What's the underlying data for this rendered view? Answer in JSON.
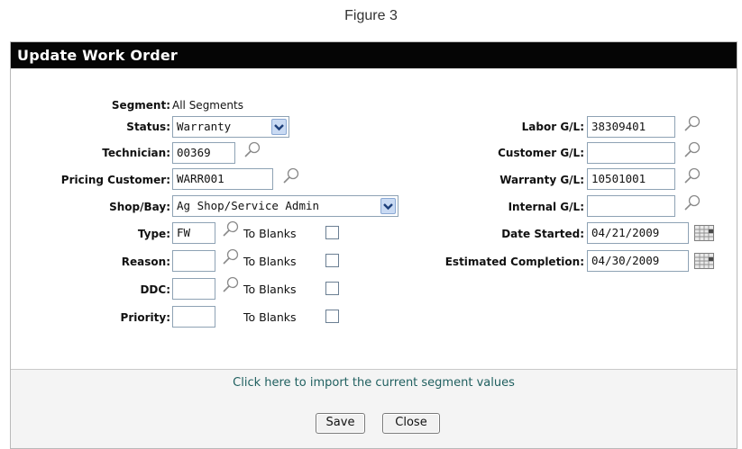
{
  "caption": "Figure 3",
  "dialog": {
    "title": "Update Work Order",
    "segment": {
      "label": "Segment:",
      "value": "All Segments"
    },
    "status": {
      "label": "Status:",
      "value": "Warranty"
    },
    "technician": {
      "label": "Technician:",
      "value": "00369"
    },
    "pricing_customer": {
      "label": "Pricing Customer:",
      "value": "WARR001"
    },
    "shop_bay": {
      "label": "Shop/Bay:",
      "value": "Ag Shop/Service Admin"
    },
    "type": {
      "label": "Type:",
      "value": "FW",
      "to_blanks": "To Blanks"
    },
    "reason": {
      "label": "Reason:",
      "value": "",
      "to_blanks": "To Blanks"
    },
    "ddc": {
      "label": "DDC:",
      "value": "",
      "to_blanks": "To Blanks"
    },
    "priority": {
      "label": "Priority:",
      "value": "",
      "to_blanks": "To Blanks"
    },
    "labor_gl": {
      "label": "Labor G/L:",
      "value": "38309401"
    },
    "customer_gl": {
      "label": "Customer G/L:",
      "value": ""
    },
    "warranty_gl": {
      "label": "Warranty G/L:",
      "value": "10501001"
    },
    "internal_gl": {
      "label": "Internal G/L:",
      "value": ""
    },
    "date_started": {
      "label": "Date Started:",
      "value": "04/21/2009"
    },
    "estimated_completion": {
      "label": "Estimated Completion:",
      "value": "04/30/2009"
    },
    "import_link": "Click here to import the current segment values",
    "save_label": "Save",
    "close_label": "Close"
  },
  "icons": {
    "lookup": "magnifier-icon",
    "calendar": "calendar-icon",
    "dropdown": "chevron-down-icon"
  }
}
